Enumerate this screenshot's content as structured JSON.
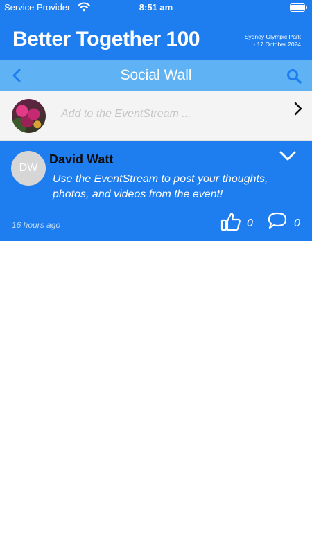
{
  "status_bar": {
    "carrier": "Service Provider",
    "time": "8:51 am",
    "wifi_icon": "wifi-icon",
    "battery_icon": "battery-icon"
  },
  "banner": {
    "brand": "Better Together 100",
    "venue_line1": "Sydney Olympic Park",
    "venue_line2": "- 17 October 2024"
  },
  "nav": {
    "title": "Social Wall",
    "back_icon": "chevron-left-icon",
    "search_icon": "search-icon"
  },
  "composer": {
    "placeholder": "Add to the EventStream ...",
    "chevron_icon": "chevron-right-icon"
  },
  "post": {
    "avatar_initials": "DW",
    "author": "David Watt",
    "body": "Use the EventStream to post your thoughts, photos, and videos from the event!",
    "timestamp": "16 hours ago",
    "likes": "0",
    "comments": "0",
    "expand_icon": "chevron-down-icon",
    "like_icon": "thumbs-up-icon",
    "comment_icon": "comment-icon"
  },
  "colors": {
    "primary_blue": "#1e7ef0",
    "nav_blue": "#5fb2f3",
    "icon_blue": "#1e7ef0",
    "avatar_grey": "#d6d6d6"
  }
}
